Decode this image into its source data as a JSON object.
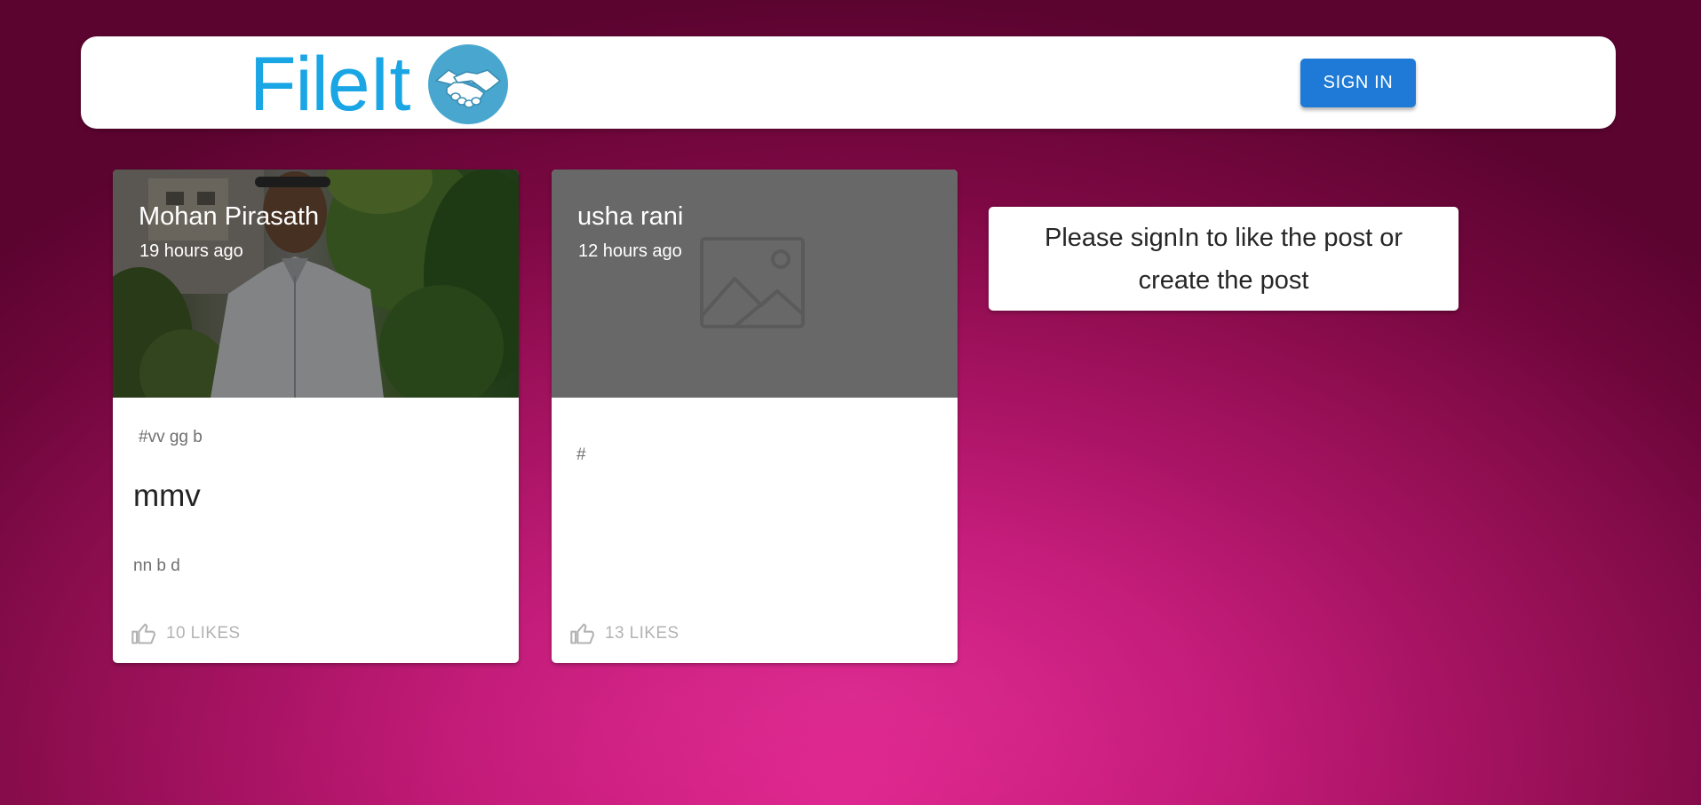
{
  "header": {
    "brand_name": "FileIt",
    "logo_icon": "handshake-icon",
    "brand_color": "#1aa6e4",
    "signin_label": "SIGN IN",
    "signin_color": "#1e7ad6"
  },
  "posts": [
    {
      "author": "Mohan Pirasath",
      "time": "19 hours ago",
      "media": "photo",
      "tags": "#vv gg b",
      "title": "mmv",
      "message": "nn b d",
      "likes_label": "10 LIKES"
    },
    {
      "author": "usha rani",
      "time": "12 hours ago",
      "media": "image-placeholder-icon",
      "tags": "#",
      "title": "",
      "message": "",
      "likes_label": "13 LIKES"
    }
  ],
  "notice": {
    "text": "Please signIn to like the post or create the post"
  },
  "colors": {
    "background_center": "#d4197f",
    "background_edge": "#5c0430",
    "like_text": "#b3b3b3"
  }
}
